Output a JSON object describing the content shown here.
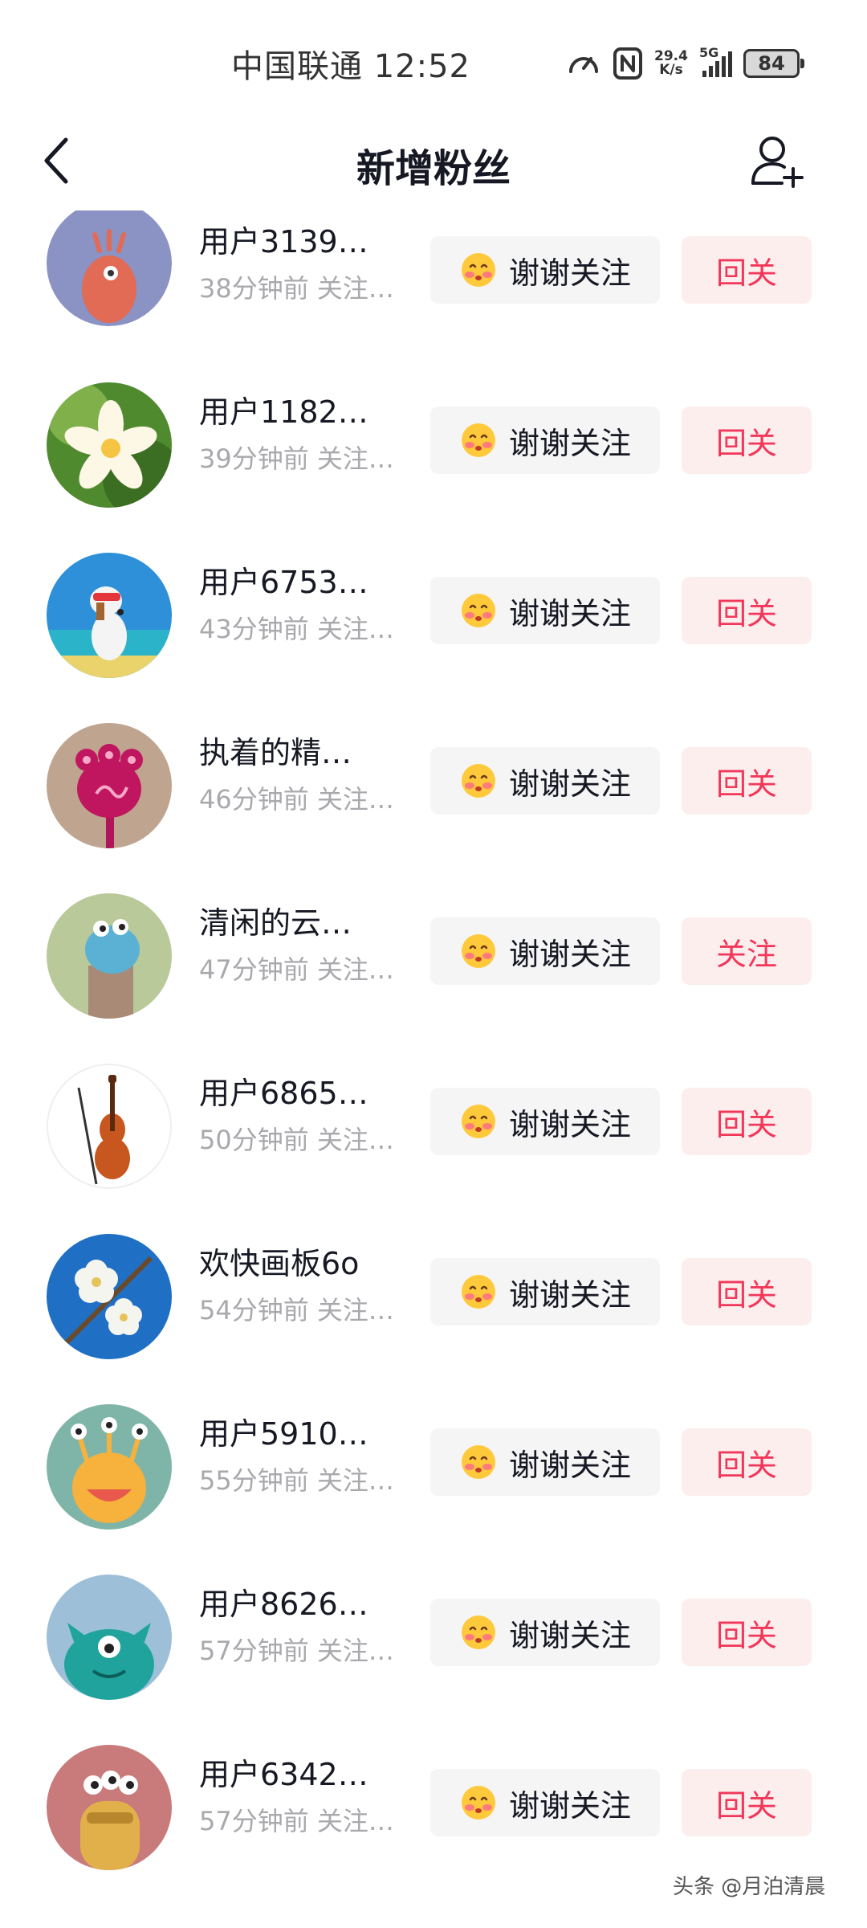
{
  "status_bar": {
    "carrier_time": "中国联通 12:52",
    "net_speed_value": "29.4",
    "net_speed_unit": "K/s",
    "signal_tag": "5G",
    "battery": "84",
    "icons": [
      "speed-icon",
      "nfc-icon",
      "signal-icon",
      "battery-icon"
    ]
  },
  "header": {
    "title": "新增粉丝",
    "back_icon": "chevron-left-icon",
    "add_icon": "add-user-icon"
  },
  "followers": [
    {
      "name": "用户3139…",
      "subtitle": "38分钟前 关注…",
      "thanks_label": "谢谢关注",
      "action_label": "回关"
    },
    {
      "name": "用户1182…",
      "subtitle": "39分钟前 关注…",
      "thanks_label": "谢谢关注",
      "action_label": "回关"
    },
    {
      "name": "用户6753…",
      "subtitle": "43分钟前 关注…",
      "thanks_label": "谢谢关注",
      "action_label": "回关"
    },
    {
      "name": "执着的精…",
      "subtitle": "46分钟前 关注…",
      "thanks_label": "谢谢关注",
      "action_label": "回关"
    },
    {
      "name": "清闲的云…",
      "subtitle": "47分钟前 关注…",
      "thanks_label": "谢谢关注",
      "action_label": "关注"
    },
    {
      "name": "用户6865…",
      "subtitle": "50分钟前 关注…",
      "thanks_label": "谢谢关注",
      "action_label": "回关"
    },
    {
      "name": "欢快画板6o",
      "subtitle": "54分钟前 关注…",
      "thanks_label": "谢谢关注",
      "action_label": "回关"
    },
    {
      "name": "用户5910…",
      "subtitle": "55分钟前 关注…",
      "thanks_label": "谢谢关注",
      "action_label": "回关"
    },
    {
      "name": "用户8626…",
      "subtitle": "57分钟前 关注…",
      "thanks_label": "谢谢关注",
      "action_label": "回关"
    },
    {
      "name": "用户6342…",
      "subtitle": "57分钟前 关注…",
      "thanks_label": "谢谢关注",
      "action_label": "回关"
    }
  ],
  "watermark": "头条 @月泊清晨",
  "colors": {
    "accent": "#f2385a",
    "follow_bg": "#fdeeee",
    "thanks_bg": "#f5f5f6",
    "secondary_text": "#a9a9ad"
  }
}
